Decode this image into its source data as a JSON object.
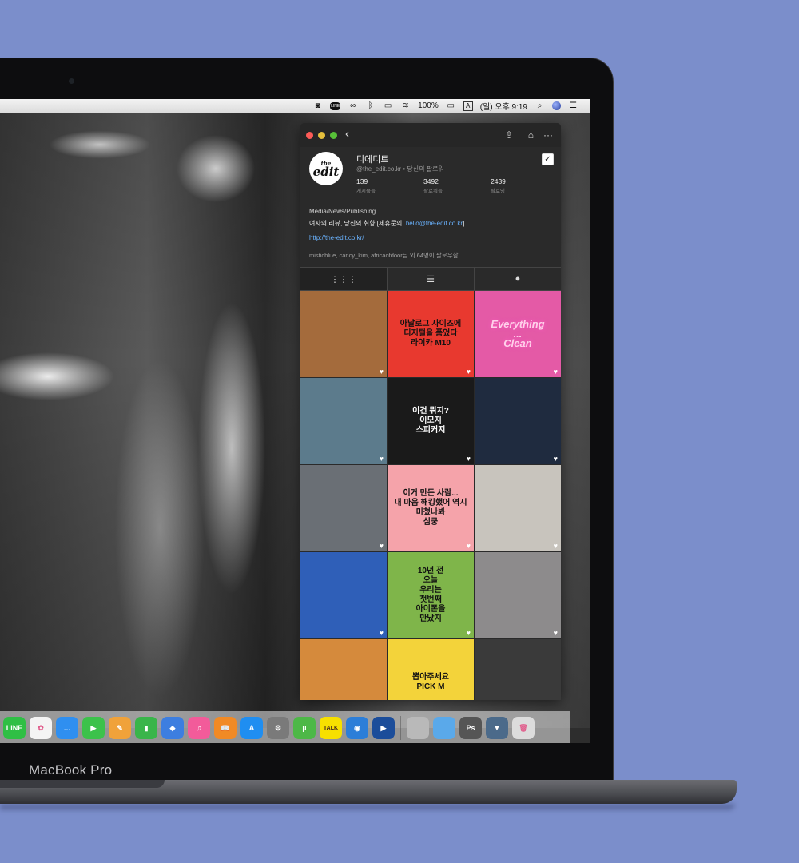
{
  "device": {
    "label": "MacBook Pro"
  },
  "menubar": {
    "battery": "100%",
    "input_source": "A",
    "clock": "(일) 오후 9:19",
    "icons": [
      "screenshot-icon",
      "line-icon",
      "creative-cloud-icon",
      "bluetooth-icon",
      "airplay-icon",
      "wifi-icon",
      "battery-icon",
      "input-source-icon",
      "spotlight-icon",
      "siri-icon",
      "notification-center-icon"
    ]
  },
  "window": {
    "controls": [
      "close",
      "minimize",
      "zoom"
    ],
    "back_icon": "‹",
    "actions": [
      "share-icon",
      "bookmark-icon",
      "more-icon"
    ]
  },
  "profile": {
    "avatar_top": "the",
    "avatar_main": "edit",
    "name": "디에디트",
    "handle": "@the_edit.co.kr • 당신의 팔로워",
    "stats": [
      {
        "value": "139",
        "label": "게시물들"
      },
      {
        "value": "3492",
        "label": "팔로워들"
      },
      {
        "value": "2439",
        "label": "팔로잉"
      }
    ],
    "category": "Media/News/Publishing",
    "bio_prefix": "여자의 리뷰, 당신의 취향 [제휴문의: ",
    "bio_email": "hello@the-edit.co.kr",
    "bio_suffix": "]",
    "link": "http://the-edit.co.kr/",
    "followed_by": "misticblue, cancy_kim, africaofdoor님 외 64명이 팔로우함"
  },
  "tabs": [
    "grid-icon",
    "list-icon",
    "tagged-icon"
  ],
  "posts": [
    {
      "caption": "",
      "color": "#a46b3c"
    },
    {
      "caption": "아날로그 사이즈에\n디지털을 품었다\n라이카 M10",
      "color": "#e8392f"
    },
    {
      "caption": "Everything\n...\nClean",
      "color": "#e45aa6"
    },
    {
      "caption": "",
      "color": "#5c7b8c"
    },
    {
      "caption": "이건 뭐지?\n이모지\n스피커지",
      "color": "#1a1a1a"
    },
    {
      "caption": "",
      "color": "#1f2b3f"
    },
    {
      "caption": "",
      "color": "#6a6f75"
    },
    {
      "caption": "이거 만든 사람...\n내 마음 해킹했어 역시\n미쳤나봐\n심쿵",
      "color": "#f5a3aa"
    },
    {
      "caption": "",
      "color": "#c8c4bd"
    },
    {
      "caption": "",
      "color": "#2f5fb8"
    },
    {
      "caption": "10년 전\n오늘\n우리는\n첫번째\n아이폰을\n만났지",
      "color": "#7fb54a"
    },
    {
      "caption": "",
      "color": "#8d8b8c"
    },
    {
      "caption": "",
      "color": "#d58a3c"
    },
    {
      "caption": "뽑아주세요\nPICK M",
      "color": "#f3d33a"
    },
    {
      "caption": "",
      "color": "#3a3a3a"
    }
  ],
  "dock": [
    {
      "name": "line",
      "color": "#2fbf45",
      "label": "LINE"
    },
    {
      "name": "photos",
      "color": "#f4f4f4",
      "label": "✿"
    },
    {
      "name": "messages",
      "color": "#2f8ff0",
      "label": "…"
    },
    {
      "name": "facetime",
      "color": "#3cc24b",
      "label": "▶"
    },
    {
      "name": "pages",
      "color": "#f0a23a",
      "label": "✎"
    },
    {
      "name": "numbers",
      "color": "#39b54a",
      "label": "▮"
    },
    {
      "name": "keynote",
      "color": "#3d7ee0",
      "label": "◆"
    },
    {
      "name": "itunes",
      "color": "#f25b9a",
      "label": "♫"
    },
    {
      "name": "ibooks",
      "color": "#f18a25",
      "label": "📖"
    },
    {
      "name": "app-store",
      "color": "#1f8ef1",
      "label": "A"
    },
    {
      "name": "system-preferences",
      "color": "#7a7a7a",
      "label": "⚙"
    },
    {
      "name": "utorrent",
      "color": "#4db847",
      "label": "µ"
    },
    {
      "name": "kakaotalk",
      "color": "#f7e000",
      "label": "TALK"
    },
    {
      "name": "image-capture",
      "color": "#2c7ed8",
      "label": "◉"
    },
    {
      "name": "quicktime",
      "color": "#1b4d9a",
      "label": "▶"
    },
    {
      "name": "photo-stack",
      "color": "#b9b9b9",
      "label": ""
    },
    {
      "name": "folder",
      "color": "#5aa9ea",
      "label": ""
    },
    {
      "name": "photoshop-docs",
      "color": "#555",
      "label": "Ps"
    },
    {
      "name": "downloads",
      "color": "#4b6a8a",
      "label": "▼"
    },
    {
      "name": "trash",
      "color": "#dcdcdc",
      "label": "🗑"
    }
  ]
}
